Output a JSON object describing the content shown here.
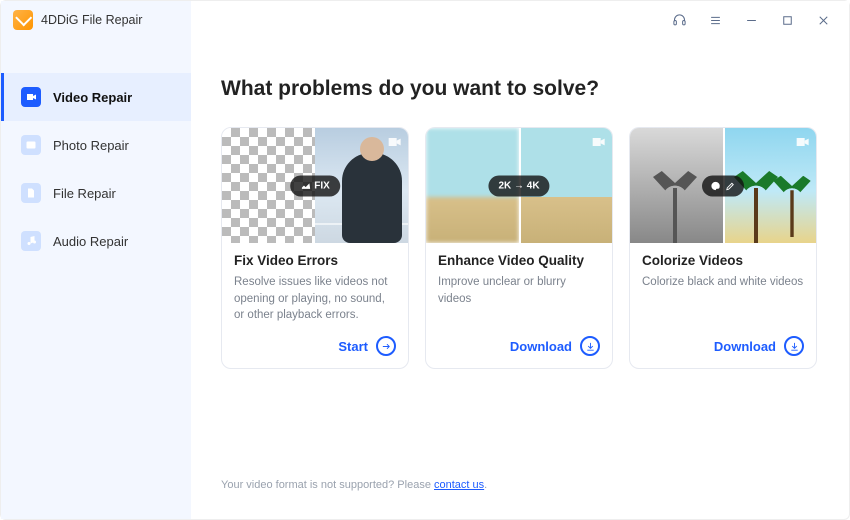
{
  "app": {
    "name": "4DDiG File Repair"
  },
  "titlebar_icons": [
    "headset",
    "menu",
    "minimize",
    "maximize",
    "close"
  ],
  "sidebar": {
    "items": [
      {
        "label": "Video Repair",
        "icon": "video-icon",
        "active": true
      },
      {
        "label": "Photo Repair",
        "icon": "photo-icon",
        "active": false
      },
      {
        "label": "File Repair",
        "icon": "file-icon",
        "active": false
      },
      {
        "label": "Audio Repair",
        "icon": "audio-icon",
        "active": false
      }
    ]
  },
  "main": {
    "heading": "What problems do you want to solve?",
    "cards": [
      {
        "title": "Fix Video Errors",
        "desc": "Resolve issues like videos not opening or playing, no sound, or other playback errors.",
        "badge": "FIX",
        "action": "Start",
        "action_kind": "arrow"
      },
      {
        "title": "Enhance Video Quality",
        "desc": "Improve unclear or blurry videos",
        "badge": "2K → 4K",
        "action": "Download",
        "action_kind": "download"
      },
      {
        "title": "Colorize Videos",
        "desc": "Colorize black and white videos",
        "badge": "",
        "action": "Download",
        "action_kind": "download"
      }
    ],
    "footer_text": "Your video format is not supported? Please ",
    "footer_link": "contact us",
    "footer_suffix": "."
  }
}
